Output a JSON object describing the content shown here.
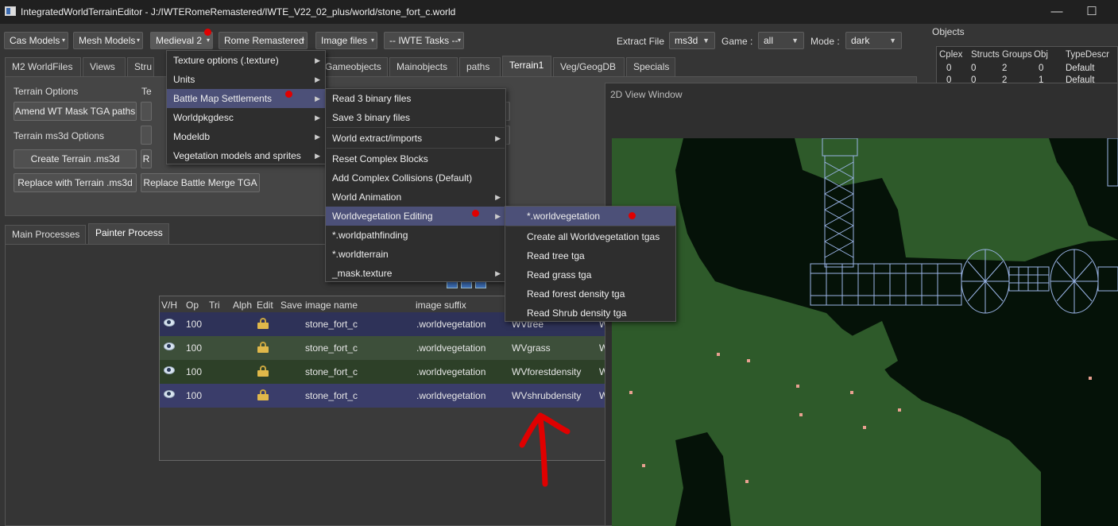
{
  "window": {
    "title": "IntegratedWorldTerrainEditor - J:/IWTERomeRemastered/IWTE_V22_02_plus/world/stone_fort_c.world",
    "minimize": "—",
    "maximize": "☐",
    "close": "✕"
  },
  "toolbar": {
    "cas_models": "Cas Models",
    "mesh_models": "Mesh Models",
    "medieval2": "Medieval 2",
    "rome_remastered": "Rome Remastered",
    "image_files": "Image files",
    "iwte_tasks": "-- IWTE Tasks --",
    "extract_file_label": "Extract File",
    "extract_file_value": "ms3d",
    "game_label": "Game :",
    "game_value": "all",
    "mode_label": "Mode :",
    "mode_value": "dark",
    "caret": "▾",
    "combo_arrow": "▼"
  },
  "main_tabs": [
    "M2 WorldFiles",
    "Views",
    "Stru",
    "Gameobjects",
    "Mainobjects",
    "paths",
    "Terrain1",
    "Veg/GeogDB",
    "Specials"
  ],
  "terrain_panel": {
    "terrain_options": "Terrain Options",
    "te_partial": "Te",
    "amend_button": "Amend WT Mask TGA paths",
    "ms3d_options": "Terrain ms3d Options",
    "create_button": "Create Terrain .ms3d",
    "r_partial": "R",
    "replace_terrain_button": "Replace with Terrain .ms3d",
    "replace_battle_button": "Replace Battle Merge TGA"
  },
  "process_tabs": [
    "Main Processes",
    "Painter Process"
  ],
  "painter_table": {
    "headers": [
      "V/H",
      "Op",
      "Tri",
      "Alph",
      "Edit",
      "Save",
      "image name",
      "image suffix"
    ],
    "rows": [
      {
        "op": "100",
        "name": "stone_fort_c",
        "suffix": ".worldvegetation",
        "type": "WVtree",
        "extra": "W"
      },
      {
        "op": "100",
        "name": "stone_fort_c",
        "suffix": ".worldvegetation",
        "type": "WVgrass",
        "extra": "W"
      },
      {
        "op": "100",
        "name": "stone_fort_c",
        "suffix": ".worldvegetation",
        "type": "WVforestdensity",
        "extra": "W"
      },
      {
        "op": "100",
        "name": "stone_fort_c",
        "suffix": ".worldvegetation",
        "type": "WVshrubdensity",
        "extra": "W"
      }
    ],
    "colors": {
      "row1": "#2e3258",
      "row2": "#3d4f3a",
      "row3": "#2d4028",
      "row4": "#3a3d6a"
    }
  },
  "objects": {
    "title": "Objects",
    "headers": [
      "Cplex",
      "Structs",
      "Groups",
      "Obj",
      "TypeDescr"
    ],
    "rows": [
      [
        "0",
        "0",
        "2",
        "0",
        "Default"
      ],
      [
        "0",
        "0",
        "2",
        "1",
        "Default"
      ]
    ]
  },
  "view2d": {
    "title": "2D View Window"
  },
  "menu_level1": {
    "items": [
      "Texture options (.texture)",
      "Units",
      "Battle Map Settlements",
      "Worldpkgdesc",
      "Modeldb",
      "Vegetation models and sprites"
    ],
    "highlighted": 2
  },
  "menu_level2": {
    "items": [
      "Read 3 binary files",
      "Save 3 binary files",
      "World extract/imports",
      "Reset Complex Blocks",
      "Add Complex Collisions (Default)",
      "World Animation",
      "Worldvegetation Editing",
      "*.worldpathfinding",
      "*.worldterrain",
      "_mask.texture"
    ],
    "submenus": [
      2,
      5,
      6,
      9
    ],
    "highlighted": 6
  },
  "menu_level3": {
    "items": [
      "*.worldvegetation",
      "Create all Worldvegetation tgas",
      "Read tree tga",
      "Read grass tga",
      "Read forest density tga",
      "Read Shrub density tga"
    ],
    "highlighted": 0
  },
  "submenu_arrow": "▶",
  "colors": {
    "accent_red": "#e00000",
    "menu_highlight": "#4c5078",
    "grass": "#2e5a2a",
    "dark_ground": "#051208",
    "wireframe": "#9ab4e6"
  }
}
